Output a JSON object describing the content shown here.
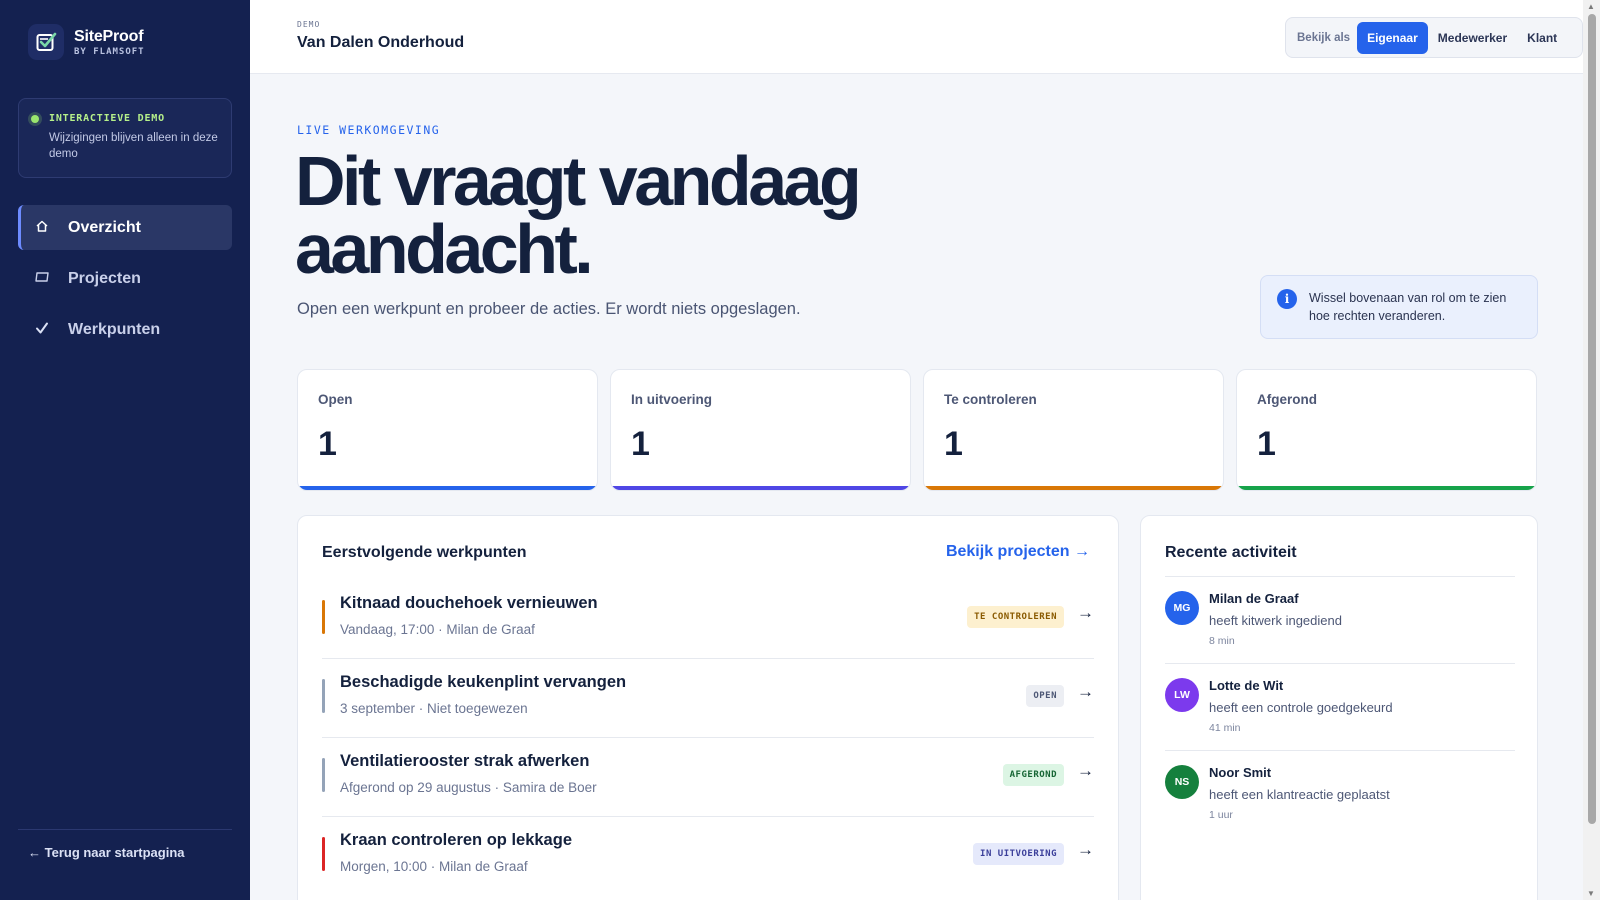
{
  "sidebar": {
    "brand_name": "SiteProof",
    "brand_sub": "BY FLAMSOFT",
    "demo_title": "INTERACTIEVE DEMO",
    "demo_text": "Wijzigingen blijven alleen in deze demo",
    "nav": [
      {
        "label": "Overzicht",
        "icon": "home-icon",
        "active": true
      },
      {
        "label": "Projecten",
        "icon": "folder-icon",
        "active": false
      },
      {
        "label": "Werkpunten",
        "icon": "check-icon",
        "active": false
      }
    ],
    "back_link": "← Terug naar startpagina"
  },
  "header": {
    "eyebrow": "DEMO",
    "title": "Van Dalen Onderhoud",
    "view_as_label": "Bekijk als",
    "roles": [
      {
        "label": "Eigenaar",
        "active": true
      },
      {
        "label": "Medewerker",
        "active": false
      },
      {
        "label": "Klant",
        "active": false
      }
    ]
  },
  "hero": {
    "eyebrow": "LIVE WERKOMGEVING",
    "title_line1": "Dit vraagt vandaag",
    "title_line2": "aandacht.",
    "subtitle": "Open een werkpunt en probeer de acties. Er wordt niets opgeslagen.",
    "info_text": "Wissel bovenaan van rol om te zien hoe rechten veranderen."
  },
  "stats": [
    {
      "label": "Open",
      "value": "1",
      "color": "#2563eb"
    },
    {
      "label": "In uitvoering",
      "value": "1",
      "color": "#4f46e5"
    },
    {
      "label": "Te controleren",
      "value": "1",
      "color": "#d97706"
    },
    {
      "label": "Afgerond",
      "value": "1",
      "color": "#16a34a"
    }
  ],
  "tasks_panel": {
    "title": "Eerstvolgende werkpunten",
    "link": "Bekijk projecten →",
    "items": [
      {
        "title": "Kitnaad douchehoek vernieuwen",
        "meta": "Vandaag, 17:00 · Milan de Graaf",
        "badge": "TE CONTROLEREN",
        "badge_bg": "#fdf0cf",
        "badge_fg": "#8a5a00",
        "accent": "#d97706",
        "arrow": "→"
      },
      {
        "title": "Beschadigde keukenplint vervangen",
        "meta": "3 september · Niet toegewezen",
        "badge": "OPEN",
        "badge_bg": "#eceef3",
        "badge_fg": "#4d5775",
        "accent": "#94a3b8",
        "arrow": "→"
      },
      {
        "title": "Ventilatierooster strak afwerken",
        "meta": "Afgerond op 29 augustus · Samira de Boer",
        "badge": "AFGEROND",
        "badge_bg": "#dcf5e4",
        "badge_fg": "#166534",
        "accent": "#94a3b8",
        "arrow": "→"
      },
      {
        "title": "Kraan controleren op lekkage",
        "meta": "Morgen, 10:00 · Milan de Graaf",
        "badge": "IN UITVOERING",
        "badge_bg": "#e5e9fb",
        "badge_fg": "#3b3f9a",
        "accent": "#dc2626",
        "arrow": "→"
      }
    ]
  },
  "activity_panel": {
    "title": "Recente activiteit",
    "items": [
      {
        "initials": "MG",
        "name": "Milan de Graaf",
        "desc": "heeft kitwerk ingediend",
        "time": "8 min",
        "color": "#2563eb"
      },
      {
        "initials": "LW",
        "name": "Lotte de Wit",
        "desc": "heeft een controle goedgekeurd",
        "time": "41 min",
        "color": "#7c3aed"
      },
      {
        "initials": "NS",
        "name": "Noor Smit",
        "desc": "heeft een klantreactie geplaatst",
        "time": "1 uur",
        "color": "#15803d"
      }
    ]
  }
}
